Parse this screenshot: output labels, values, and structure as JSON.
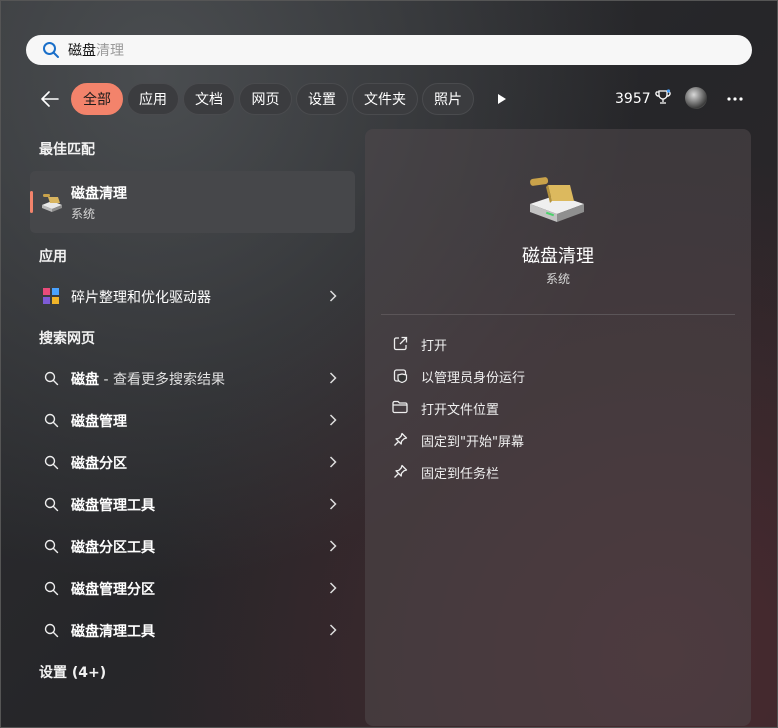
{
  "search": {
    "typed": "磁盘",
    "suggestion": "清理"
  },
  "filters": {
    "tabs": [
      {
        "label": "全部",
        "active": true
      },
      {
        "label": "应用",
        "active": false
      },
      {
        "label": "文档",
        "active": false
      },
      {
        "label": "网页",
        "active": false
      },
      {
        "label": "设置",
        "active": false
      },
      {
        "label": "文件夹",
        "active": false
      },
      {
        "label": "照片",
        "active": false
      }
    ],
    "points": "3957"
  },
  "left": {
    "best_match_heading": "最佳匹配",
    "best_match": {
      "title": "磁盘清理",
      "subtitle": "系统"
    },
    "apps_heading": "应用",
    "apps": [
      {
        "label": "碎片整理和优化驱动器"
      }
    ],
    "web_heading": "搜索网页",
    "web": [
      {
        "bold": "磁盘",
        "rest": " - 查看更多搜索结果"
      },
      {
        "bold": "磁盘管理",
        "rest": ""
      },
      {
        "bold": "磁盘分区",
        "rest": ""
      },
      {
        "bold": "磁盘管理工具",
        "rest": ""
      },
      {
        "bold": "磁盘分区工具",
        "rest": ""
      },
      {
        "bold": "磁盘管理分区",
        "rest": ""
      },
      {
        "bold": "磁盘清理工具",
        "rest": ""
      }
    ],
    "settings_heading": "设置 (4+)"
  },
  "panel": {
    "title": "磁盘清理",
    "subtitle": "系统",
    "actions": [
      {
        "label": "打开",
        "icon": "open-external-icon"
      },
      {
        "label": "以管理员身份运行",
        "icon": "shield-admin-icon"
      },
      {
        "label": "打开文件位置",
        "icon": "folder-icon"
      },
      {
        "label": "固定到\"开始\"屏幕",
        "icon": "pin-icon"
      },
      {
        "label": "固定到任务栏",
        "icon": "pin-icon"
      }
    ]
  },
  "colors": {
    "accent": "#f3836b",
    "search_bg": "#f7f7f7",
    "chip_bg": "#3b3c3f"
  }
}
